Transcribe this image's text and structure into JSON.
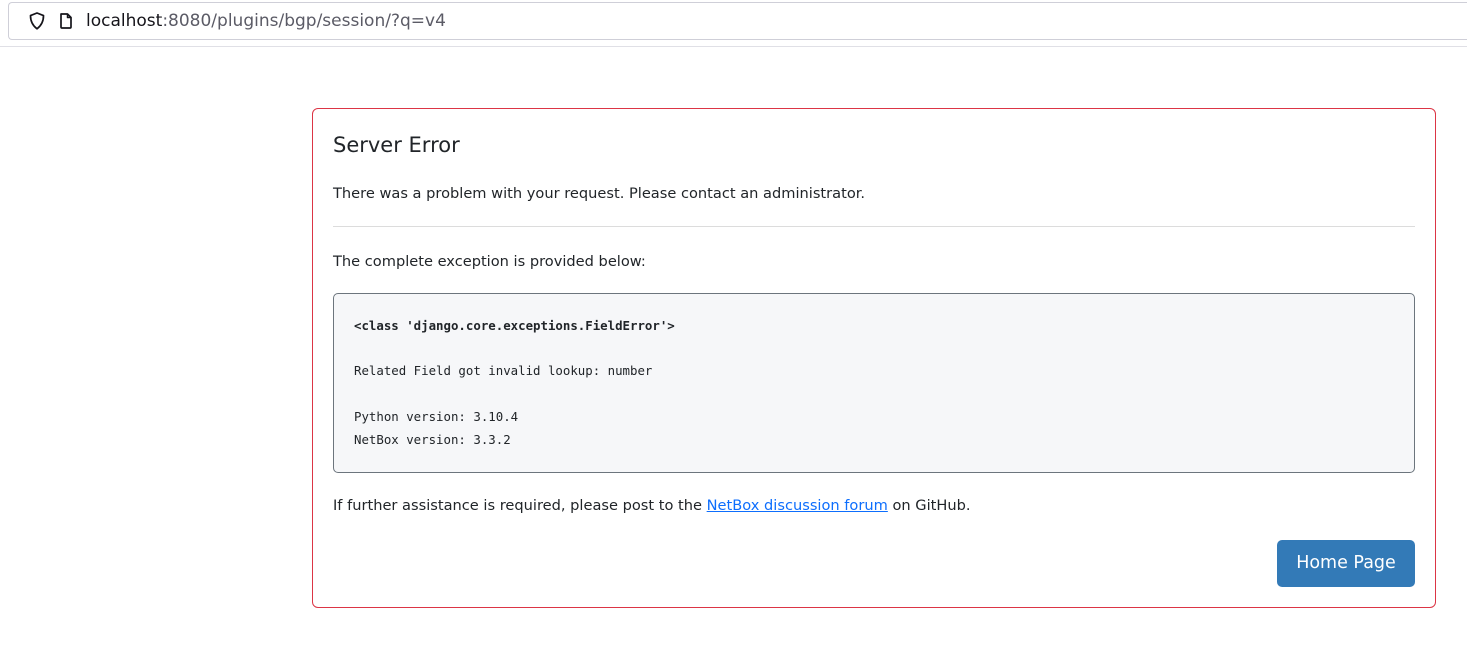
{
  "browser": {
    "url_host": "localhost",
    "url_rest": ":8080/plugins/bgp/session/?q=v4",
    "icons": [
      "shield-icon",
      "page-icon"
    ]
  },
  "error": {
    "title": "Server Error",
    "lead": "There was a problem with your request. Please contact an administrator.",
    "intro": "The complete exception is provided below:",
    "exception": {
      "class_line": "<class 'django.core.exceptions.FieldError'>",
      "message": "Related Field got invalid lookup: number",
      "python_version": "Python version: 3.10.4",
      "netbox_version": "NetBox version: 3.3.2"
    },
    "help_prefix": "If further assistance is required, please post to the ",
    "help_link": "NetBox discussion forum",
    "help_suffix": " on GitHub.",
    "home_button": "Home Page"
  },
  "colors": {
    "card_border": "#dc3545",
    "button_bg": "#337ab7",
    "link": "#0d6efd",
    "exception_bg": "#f6f7f9"
  }
}
